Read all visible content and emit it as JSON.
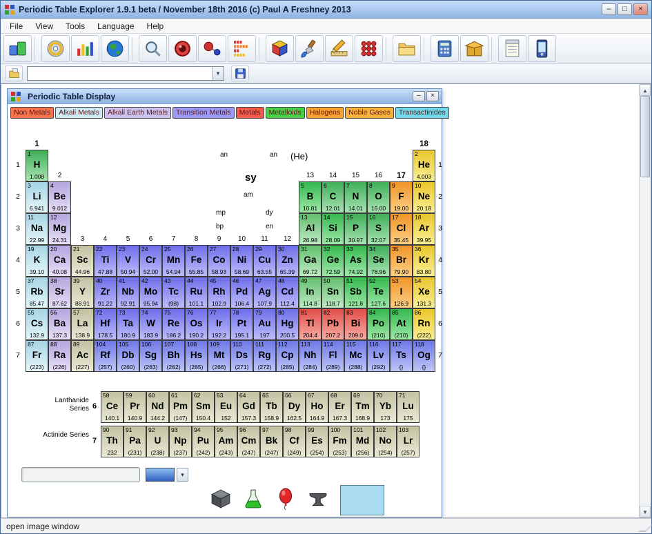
{
  "window": {
    "title": "Periodic Table Explorer 1.9.1 beta / November 18th 2016 (c) Paul A Freshney 2013",
    "controls": {
      "minimize": "–",
      "maximize": "□",
      "close": "×"
    }
  },
  "menu": {
    "items": [
      "File",
      "View",
      "Tools",
      "Language",
      "Help"
    ]
  },
  "toolbar": {
    "icons": [
      "periodic-table-icon",
      "disc-icon",
      "bar-chart-icon",
      "globe-icon",
      "magnifier-icon",
      "lens-icon",
      "molecule-icon",
      "equalizer-icon",
      "cube-icon",
      "paintbrush-icon",
      "drafting-icon",
      "dots-grid-icon",
      "folder-icon",
      "calculator-icon",
      "package-icon",
      "notepad-icon",
      "pda-icon"
    ]
  },
  "toolbar2": {
    "combo_value": "",
    "arrow": "▾"
  },
  "inner_window": {
    "title": "Periodic Table Display",
    "controls": {
      "minimize": "–",
      "close": "×"
    }
  },
  "legend": [
    {
      "label": "Non Metals",
      "bg": "#F5734D"
    },
    {
      "label": "Alkali Metals",
      "bg": "#CDEAF5"
    },
    {
      "label": "Alkali Earth Metals",
      "bg": "#CDC3EF"
    },
    {
      "label": "Transition Metals",
      "bg": "#9B9BF7"
    },
    {
      "label": "Metals",
      "bg": "#F55B4B"
    },
    {
      "label": "Metalloids",
      "bg": "#49D049"
    },
    {
      "label": "Halogens",
      "bg": "#F9A030"
    },
    {
      "label": "Noble Gases",
      "bg": "#F9B23C"
    },
    {
      "label": "Transactinides",
      "bg": "#74D9EA"
    }
  ],
  "key": {
    "top_left": "an",
    "top_right": "an",
    "config": "(He)",
    "symbol": "sy",
    "mass": "am",
    "mp": "mp",
    "dy": "dy",
    "bp": "bp",
    "en": "en"
  },
  "groups": [
    {
      "label": "1",
      "col": 1,
      "level": "1",
      "bold": true
    },
    {
      "label": "2",
      "col": 2,
      "level": "2",
      "bold": false
    },
    {
      "label": "3",
      "col": 3,
      "level": "4",
      "bold": false
    },
    {
      "label": "4",
      "col": 4,
      "level": "4",
      "bold": false
    },
    {
      "label": "5",
      "col": 5,
      "level": "4",
      "bold": false
    },
    {
      "label": "6",
      "col": 6,
      "level": "4",
      "bold": false
    },
    {
      "label": "7",
      "col": 7,
      "level": "4",
      "bold": false
    },
    {
      "label": "8",
      "col": 8,
      "level": "4",
      "bold": false
    },
    {
      "label": "9",
      "col": 9,
      "level": "4",
      "bold": false
    },
    {
      "label": "10",
      "col": 10,
      "level": "4",
      "bold": false
    },
    {
      "label": "11",
      "col": 11,
      "level": "4",
      "bold": false
    },
    {
      "label": "12",
      "col": 12,
      "level": "4",
      "bold": false
    },
    {
      "label": "13",
      "col": 13,
      "level": "2",
      "bold": false
    },
    {
      "label": "14",
      "col": 14,
      "level": "2",
      "bold": false
    },
    {
      "label": "15",
      "col": 15,
      "level": "2",
      "bold": false
    },
    {
      "label": "16",
      "col": 16,
      "level": "2",
      "bold": false
    },
    {
      "label": "17",
      "col": 17,
      "level": "2",
      "bold": true
    },
    {
      "label": "18",
      "col": 18,
      "level": "1",
      "bold": true
    }
  ],
  "periods": [
    "1",
    "2",
    "3",
    "4",
    "5",
    "6",
    "7"
  ],
  "series": {
    "lanthanide": "Lanthanide Series",
    "lanthanide_period": "6",
    "actinide": "Actinide Series",
    "actinide_period": "7"
  },
  "colors": {
    "nm": [
      "#3FAE58",
      "#A9E4B4"
    ],
    "md": [
      "#35B84E",
      "#9FE8A9"
    ],
    "pt": [
      "#63BE6E",
      "#BFEAC4"
    ],
    "ak": [
      "#A6D4E4",
      "#E6F7FB"
    ],
    "ae": [
      "#B5A6DE",
      "#E7DFF6"
    ],
    "tm": [
      "#6E6EEA",
      "#BDBDFB"
    ],
    "ta": [
      "#6E78E6",
      "#BDC6F8"
    ],
    "ml": [
      "#E25048",
      "#F5ACA4"
    ],
    "hg": [
      "#F09428",
      "#FBD186"
    ],
    "ng": [
      "#E9C62A",
      "#FAF096"
    ],
    "re": [
      "#C2C2A2",
      "#EAEAD6"
    ]
  },
  "elements": [
    {
      "n": 1,
      "s": "H",
      "m": "1.008",
      "c": "nm",
      "r": "1",
      "g": 1
    },
    {
      "n": 2,
      "s": "He",
      "m": "4.003",
      "c": "ng",
      "r": "1",
      "g": 18
    },
    {
      "n": 3,
      "s": "Li",
      "m": "6.941",
      "c": "ak",
      "r": "2",
      "g": 1
    },
    {
      "n": 4,
      "s": "Be",
      "m": "9.012",
      "c": "ae",
      "r": "2",
      "g": 2
    },
    {
      "n": 5,
      "s": "B",
      "m": "10.81",
      "c": "md",
      "r": "2",
      "g": 13
    },
    {
      "n": 6,
      "s": "C",
      "m": "12.01",
      "c": "nm",
      "r": "2",
      "g": 14
    },
    {
      "n": 7,
      "s": "N",
      "m": "14.01",
      "c": "nm",
      "r": "2",
      "g": 15
    },
    {
      "n": 8,
      "s": "O",
      "m": "16.00",
      "c": "nm",
      "r": "2",
      "g": 16
    },
    {
      "n": 9,
      "s": "F",
      "m": "19.00",
      "c": "hg",
      "r": "2",
      "g": 17
    },
    {
      "n": 10,
      "s": "Ne",
      "m": "20.18",
      "c": "ng",
      "r": "2",
      "g": 18
    },
    {
      "n": 11,
      "s": "Na",
      "m": "22.99",
      "c": "ak",
      "r": "3",
      "g": 1
    },
    {
      "n": 12,
      "s": "Mg",
      "m": "24.31",
      "c": "ae",
      "r": "3",
      "g": 2
    },
    {
      "n": 13,
      "s": "Al",
      "m": "26.98",
      "c": "pt",
      "r": "3",
      "g": 13
    },
    {
      "n": 14,
      "s": "Si",
      "m": "28.09",
      "c": "md",
      "r": "3",
      "g": 14
    },
    {
      "n": 15,
      "s": "P",
      "m": "30.97",
      "c": "nm",
      "r": "3",
      "g": 15
    },
    {
      "n": 16,
      "s": "S",
      "m": "32.07",
      "c": "nm",
      "r": "3",
      "g": 16
    },
    {
      "n": 17,
      "s": "Cl",
      "m": "35.45",
      "c": "hg",
      "r": "3",
      "g": 17
    },
    {
      "n": 18,
      "s": "Ar",
      "m": "39.95",
      "c": "ng",
      "r": "3",
      "g": 18
    },
    {
      "n": 19,
      "s": "K",
      "m": "39.10",
      "c": "ak",
      "r": "4",
      "g": 1
    },
    {
      "n": 20,
      "s": "Ca",
      "m": "40.08",
      "c": "ae",
      "r": "4",
      "g": 2
    },
    {
      "n": 21,
      "s": "Sc",
      "m": "44.96",
      "c": "re",
      "r": "4",
      "g": 3
    },
    {
      "n": 22,
      "s": "Ti",
      "m": "47.88",
      "c": "tm",
      "r": "4",
      "g": 4
    },
    {
      "n": 23,
      "s": "V",
      "m": "50.94",
      "c": "tm",
      "r": "4",
      "g": 5
    },
    {
      "n": 24,
      "s": "Cr",
      "m": "52.00",
      "c": "tm",
      "r": "4",
      "g": 6
    },
    {
      "n": 25,
      "s": "Mn",
      "m": "54.94",
      "c": "tm",
      "r": "4",
      "g": 7
    },
    {
      "n": 26,
      "s": "Fe",
      "m": "55.85",
      "c": "tm",
      "r": "4",
      "g": 8
    },
    {
      "n": 27,
      "s": "Co",
      "m": "58.93",
      "c": "tm",
      "r": "4",
      "g": 9
    },
    {
      "n": 28,
      "s": "Ni",
      "m": "58.69",
      "c": "tm",
      "r": "4",
      "g": 10
    },
    {
      "n": 29,
      "s": "Cu",
      "m": "63.55",
      "c": "tm",
      "r": "4",
      "g": 11
    },
    {
      "n": 30,
      "s": "Zn",
      "m": "65.39",
      "c": "tm",
      "r": "4",
      "g": 12
    },
    {
      "n": 31,
      "s": "Ga",
      "m": "69.72",
      "c": "pt",
      "r": "4",
      "g": 13
    },
    {
      "n": 32,
      "s": "Ge",
      "m": "72.59",
      "c": "md",
      "r": "4",
      "g": 14
    },
    {
      "n": 33,
      "s": "As",
      "m": "74.92",
      "c": "md",
      "r": "4",
      "g": 15
    },
    {
      "n": 34,
      "s": "Se",
      "m": "78.96",
      "c": "nm",
      "r": "4",
      "g": 16
    },
    {
      "n": 35,
      "s": "Br",
      "m": "79.90",
      "c": "hg",
      "r": "4",
      "g": 17
    },
    {
      "n": 36,
      "s": "Kr",
      "m": "83.80",
      "c": "ng",
      "r": "4",
      "g": 18
    },
    {
      "n": 37,
      "s": "Rb",
      "m": "85.47",
      "c": "ak",
      "r": "5",
      "g": 1
    },
    {
      "n": 38,
      "s": "Sr",
      "m": "87.62",
      "c": "ae",
      "r": "5",
      "g": 2
    },
    {
      "n": 39,
      "s": "Y",
      "m": "88.91",
      "c": "re",
      "r": "5",
      "g": 3
    },
    {
      "n": 40,
      "s": "Zr",
      "m": "91.22",
      "c": "tm",
      "r": "5",
      "g": 4
    },
    {
      "n": 41,
      "s": "Nb",
      "m": "92.91",
      "c": "tm",
      "r": "5",
      "g": 5
    },
    {
      "n": 42,
      "s": "Mo",
      "m": "95.94",
      "c": "tm",
      "r": "5",
      "g": 6
    },
    {
      "n": 43,
      "s": "Tc",
      "m": "(98)",
      "c": "tm",
      "r": "5",
      "g": 7
    },
    {
      "n": 44,
      "s": "Ru",
      "m": "101.1",
      "c": "tm",
      "r": "5",
      "g": 8
    },
    {
      "n": 45,
      "s": "Rh",
      "m": "102.9",
      "c": "tm",
      "r": "5",
      "g": 9
    },
    {
      "n": 46,
      "s": "Pd",
      "m": "106.4",
      "c": "tm",
      "r": "5",
      "g": 10
    },
    {
      "n": 47,
      "s": "Ag",
      "m": "107.9",
      "c": "tm",
      "r": "5",
      "g": 11
    },
    {
      "n": 48,
      "s": "Cd",
      "m": "112.4",
      "c": "tm",
      "r": "5",
      "g": 12
    },
    {
      "n": 49,
      "s": "In",
      "m": "114.8",
      "c": "pt",
      "r": "5",
      "g": 13
    },
    {
      "n": 50,
      "s": "Sn",
      "m": "118.7",
      "c": "pt",
      "r": "5",
      "g": 14
    },
    {
      "n": 51,
      "s": "Sb",
      "m": "121.8",
      "c": "md",
      "r": "5",
      "g": 15
    },
    {
      "n": 52,
      "s": "Te",
      "m": "127.6",
      "c": "md",
      "r": "5",
      "g": 16
    },
    {
      "n": 53,
      "s": "I",
      "m": "126.9",
      "c": "hg",
      "r": "5",
      "g": 17
    },
    {
      "n": 54,
      "s": "Xe",
      "m": "131.3",
      "c": "ng",
      "r": "5",
      "g": 18
    },
    {
      "n": 55,
      "s": "Cs",
      "m": "132.9",
      "c": "ak",
      "r": "6",
      "g": 1
    },
    {
      "n": 56,
      "s": "Ba",
      "m": "137.3",
      "c": "ae",
      "r": "6",
      "g": 2
    },
    {
      "n": 57,
      "s": "La",
      "m": "138.9",
      "c": "re",
      "r": "6",
      "g": 3
    },
    {
      "n": 72,
      "s": "Hf",
      "m": "178.5",
      "c": "tm",
      "r": "6",
      "g": 4
    },
    {
      "n": 73,
      "s": "Ta",
      "m": "180.9",
      "c": "tm",
      "r": "6",
      "g": 5
    },
    {
      "n": 74,
      "s": "W",
      "m": "183.9",
      "c": "tm",
      "r": "6",
      "g": 6
    },
    {
      "n": 75,
      "s": "Re",
      "m": "186.2",
      "c": "tm",
      "r": "6",
      "g": 7
    },
    {
      "n": 76,
      "s": "Os",
      "m": "190.2",
      "c": "tm",
      "r": "6",
      "g": 8
    },
    {
      "n": 77,
      "s": "Ir",
      "m": "192.2",
      "c": "tm",
      "r": "6",
      "g": 9
    },
    {
      "n": 78,
      "s": "Pt",
      "m": "195.1",
      "c": "tm",
      "r": "6",
      "g": 10
    },
    {
      "n": 79,
      "s": "Au",
      "m": "197",
      "c": "tm",
      "r": "6",
      "g": 11
    },
    {
      "n": 80,
      "s": "Hg",
      "m": "200.5",
      "c": "tm",
      "r": "6",
      "g": 12
    },
    {
      "n": 81,
      "s": "Tl",
      "m": "204.4",
      "c": "ml",
      "r": "6",
      "g": 13
    },
    {
      "n": 82,
      "s": "Pb",
      "m": "207.2",
      "c": "ml",
      "r": "6",
      "g": 14
    },
    {
      "n": 83,
      "s": "Bi",
      "m": "209.0",
      "c": "ml",
      "r": "6",
      "g": 15
    },
    {
      "n": 84,
      "s": "Po",
      "m": "(210)",
      "c": "md",
      "r": "6",
      "g": 16
    },
    {
      "n": 85,
      "s": "At",
      "m": "(210)",
      "c": "md",
      "r": "6",
      "g": 17
    },
    {
      "n": 86,
      "s": "Rn",
      "m": "(222)",
      "c": "ng",
      "r": "6",
      "g": 18
    },
    {
      "n": 87,
      "s": "Fr",
      "m": "(223)",
      "c": "ak",
      "r": "7",
      "g": 1
    },
    {
      "n": 88,
      "s": "Ra",
      "m": "(226)",
      "c": "ae",
      "r": "7",
      "g": 2
    },
    {
      "n": 89,
      "s": "Ac",
      "m": "(227)",
      "c": "re",
      "r": "7",
      "g": 3
    },
    {
      "n": 104,
      "s": "Rf",
      "m": "(257)",
      "c": "ta",
      "r": "7",
      "g": 4
    },
    {
      "n": 105,
      "s": "Db",
      "m": "(260)",
      "c": "ta",
      "r": "7",
      "g": 5
    },
    {
      "n": 106,
      "s": "Sg",
      "m": "(263)",
      "c": "ta",
      "r": "7",
      "g": 6
    },
    {
      "n": 107,
      "s": "Bh",
      "m": "(262)",
      "c": "ta",
      "r": "7",
      "g": 7
    },
    {
      "n": 108,
      "s": "Hs",
      "m": "(265)",
      "c": "ta",
      "r": "7",
      "g": 8
    },
    {
      "n": 109,
      "s": "Mt",
      "m": "(266)",
      "c": "ta",
      "r": "7",
      "g": 9
    },
    {
      "n": 110,
      "s": "Ds",
      "m": "(271)",
      "c": "ta",
      "r": "7",
      "g": 10
    },
    {
      "n": 111,
      "s": "Rg",
      "m": "(272)",
      "c": "ta",
      "r": "7",
      "g": 11
    },
    {
      "n": 112,
      "s": "Cp",
      "m": "(285)",
      "c": "ta",
      "r": "7",
      "g": 12
    },
    {
      "n": 113,
      "s": "Nh",
      "m": "(284)",
      "c": "ta",
      "r": "7",
      "g": 13
    },
    {
      "n": 114,
      "s": "Fl",
      "m": "(289)",
      "c": "ta",
      "r": "7",
      "g": 14
    },
    {
      "n": 115,
      "s": "Mc",
      "m": "(288)",
      "c": "ta",
      "r": "7",
      "g": 15
    },
    {
      "n": 116,
      "s": "Lv",
      "m": "(292)",
      "c": "ta",
      "r": "7",
      "g": 16
    },
    {
      "n": 117,
      "s": "Ts",
      "m": "{}",
      "c": "ta",
      "r": "7",
      "g": 17
    },
    {
      "n": 118,
      "s": "Og",
      "m": "{}",
      "c": "ta",
      "r": "7",
      "g": 18
    },
    {
      "n": 58,
      "s": "Ce",
      "m": "140.1",
      "c": "re",
      "r": "l",
      "g": 1
    },
    {
      "n": 59,
      "s": "Pr",
      "m": "140.9",
      "c": "re",
      "r": "l",
      "g": 2
    },
    {
      "n": 60,
      "s": "Nd",
      "m": "144.2",
      "c": "re",
      "r": "l",
      "g": 3
    },
    {
      "n": 61,
      "s": "Pm",
      "m": "(147)",
      "c": "re",
      "r": "l",
      "g": 4
    },
    {
      "n": 62,
      "s": "Sm",
      "m": "150.4",
      "c": "re",
      "r": "l",
      "g": 5
    },
    {
      "n": 63,
      "s": "Eu",
      "m": "152",
      "c": "re",
      "r": "l",
      "g": 6
    },
    {
      "n": 64,
      "s": "Gd",
      "m": "157.3",
      "c": "re",
      "r": "l",
      "g": 7
    },
    {
      "n": 65,
      "s": "Tb",
      "m": "158.9",
      "c": "re",
      "r": "l",
      "g": 8
    },
    {
      "n": 66,
      "s": "Dy",
      "m": "162.5",
      "c": "re",
      "r": "l",
      "g": 9
    },
    {
      "n": 67,
      "s": "Ho",
      "m": "164.9",
      "c": "re",
      "r": "l",
      "g": 10
    },
    {
      "n": 68,
      "s": "Er",
      "m": "167.3",
      "c": "re",
      "r": "l",
      "g": 11
    },
    {
      "n": 69,
      "s": "Tm",
      "m": "168.9",
      "c": "re",
      "r": "l",
      "g": 12
    },
    {
      "n": 70,
      "s": "Yb",
      "m": "173",
      "c": "re",
      "r": "l",
      "g": 13
    },
    {
      "n": 71,
      "s": "Lu",
      "m": "175",
      "c": "re",
      "r": "l",
      "g": 14
    },
    {
      "n": 90,
      "s": "Th",
      "m": "232",
      "c": "re",
      "r": "a",
      "g": 1
    },
    {
      "n": 91,
      "s": "Pa",
      "m": "(231)",
      "c": "re",
      "r": "a",
      "g": 2
    },
    {
      "n": 92,
      "s": "U",
      "m": "(238)",
      "c": "re",
      "r": "a",
      "g": 3
    },
    {
      "n": 93,
      "s": "Np",
      "m": "(237)",
      "c": "re",
      "r": "a",
      "g": 4
    },
    {
      "n": 94,
      "s": "Pu",
      "m": "(242)",
      "c": "re",
      "r": "a",
      "g": 5
    },
    {
      "n": 95,
      "s": "Am",
      "m": "(243)",
      "c": "re",
      "r": "a",
      "g": 6
    },
    {
      "n": 96,
      "s": "Cm",
      "m": "(247)",
      "c": "re",
      "r": "a",
      "g": 7
    },
    {
      "n": 97,
      "s": "Bk",
      "m": "(247)",
      "c": "re",
      "r": "a",
      "g": 8
    },
    {
      "n": 98,
      "s": "Cf",
      "m": "(249)",
      "c": "re",
      "r": "a",
      "g": 9
    },
    {
      "n": 99,
      "s": "Es",
      "m": "(254)",
      "c": "re",
      "r": "a",
      "g": 10
    },
    {
      "n": 100,
      "s": "Fm",
      "m": "(253)",
      "c": "re",
      "r": "a",
      "g": 11
    },
    {
      "n": 101,
      "s": "Md",
      "m": "(256)",
      "c": "re",
      "r": "a",
      "g": 12
    },
    {
      "n": 102,
      "s": "No",
      "m": "(254)",
      "c": "re",
      "r": "a",
      "g": 13
    },
    {
      "n": 103,
      "s": "Lr",
      "m": "(257)",
      "c": "re",
      "r": "a",
      "g": 14
    }
  ],
  "bottom": {
    "text_value": "",
    "arrow": "▾",
    "color_top": "#8FC0F0",
    "color_bottom": "#3060C0",
    "icons": [
      "cube3d-icon",
      "flask-icon",
      "balloon-icon",
      "anvil-icon"
    ],
    "preview_color": "#ABDBF0"
  },
  "scrollbar": {
    "up": "▲",
    "down": "▼"
  },
  "status": {
    "text": "open image window"
  }
}
